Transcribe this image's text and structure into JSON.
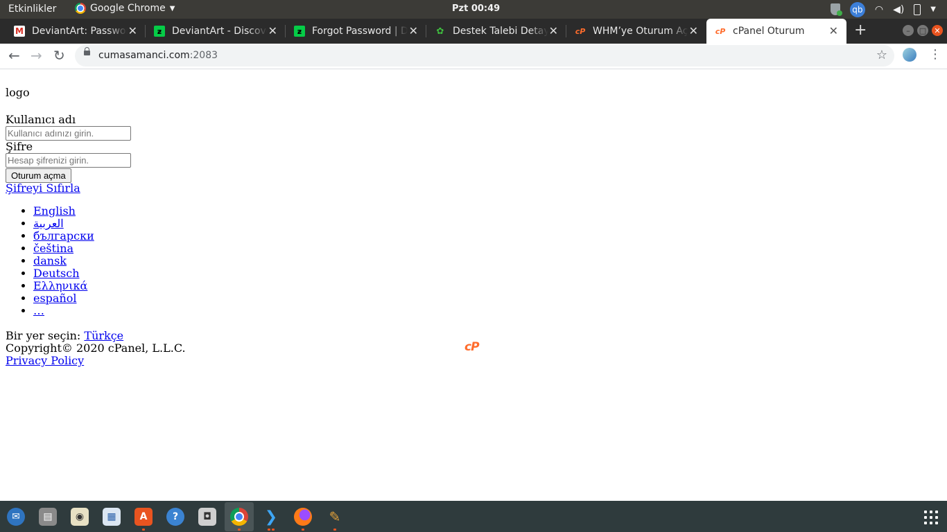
{
  "topbar": {
    "activities": "Etkinlikler",
    "app_name": "Google Chrome",
    "clock": "Pzt 00:49",
    "qb_label": "qb"
  },
  "tabs": [
    {
      "title": "DeviantArt: Password",
      "favicon": "gmail-icon"
    },
    {
      "title": "DeviantArt - Discover",
      "favicon": "deviantart-icon"
    },
    {
      "title": "Forgot Password | D",
      "favicon": "deviantart-icon"
    },
    {
      "title": "Destek Talebi Detayı",
      "favicon": "support-icon"
    },
    {
      "title": "WHM’ye Oturum Aç",
      "favicon": "cpanel-icon"
    },
    {
      "title": "cPanel Oturum",
      "favicon": "cpanel-icon",
      "active": true
    }
  ],
  "address": {
    "host": "cumasamanci.com",
    "port": ":2083"
  },
  "login": {
    "logo_alt": "logo",
    "username_label": "Kullanıcı adı",
    "username_placeholder": "Kullanıcı adınızı girin.",
    "password_label": "Şifre",
    "password_placeholder": "Hesap şifrenizi girin.",
    "submit_label": "Oturum açma",
    "reset_link": "Şifreyi Sıfırla"
  },
  "languages": [
    "English",
    "العربية",
    "български",
    "čeština",
    "dansk",
    "Deutsch",
    "Ελληνικά",
    "español",
    "…"
  ],
  "footer": {
    "locale_prompt": "Bir yer seçin: ",
    "locale_current": "Türkçe",
    "copyright": "Copyright© 2020 cPanel, L.L.C.",
    "privacy": "Privacy Policy",
    "cpanel_logo_text": "cP"
  },
  "colors": {
    "cpanel_orange": "#ff6c2c",
    "ubuntu_orange": "#e95420",
    "link_blue": "#0000ee"
  },
  "dock": [
    "thunderbird-icon",
    "files-icon",
    "rhythmbox-icon",
    "libreoffice-writer-icon",
    "software-center-icon",
    "help-icon",
    "screenshot-icon",
    "chrome-icon",
    "vscode-icon",
    "firefox-icon",
    "paint-icon"
  ]
}
